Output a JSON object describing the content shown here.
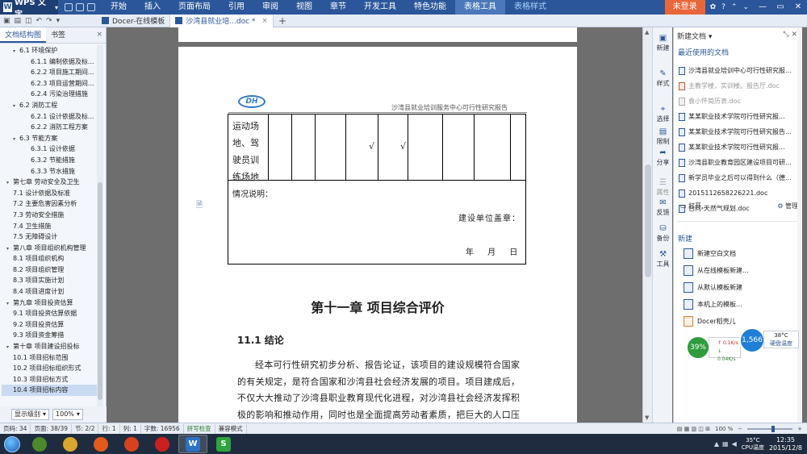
{
  "menubar": {
    "app_title": "WPS 文字",
    "menus": [
      "开始",
      "插入",
      "页面布局",
      "引用",
      "审阅",
      "视图",
      "章节",
      "开发工具",
      "特色功能"
    ],
    "tool_tabs": [
      "表格工具",
      "表格样式"
    ],
    "login": "未登录"
  },
  "tabbar": {
    "tabs": [
      {
        "label": "Docer-在线模板"
      },
      {
        "label": "沙湾县就业培...doc *"
      }
    ],
    "add": "+"
  },
  "left_panel": {
    "tabs": [
      "文档结构图",
      "书签"
    ],
    "outline": [
      {
        "label": "6.1 环境保护",
        "level": 2,
        "toggle": "▾"
      },
      {
        "label": "6.1.1 编制依据及标...",
        "level": 3
      },
      {
        "label": "6.2.2 项目施工期间...",
        "level": 3
      },
      {
        "label": "6.2.3 项目运营期间...",
        "level": 3
      },
      {
        "label": "6.2.4 污染治理措施",
        "level": 3
      },
      {
        "label": "6.2 消防工程",
        "level": 2,
        "toggle": "▾"
      },
      {
        "label": "6.2.1 设计依据及标...",
        "level": 3
      },
      {
        "label": "6.2.2 消防工程方案",
        "level": 3
      },
      {
        "label": "6.3 节能方案",
        "level": 2,
        "toggle": "▾"
      },
      {
        "label": "6.3.1 设计依据",
        "level": 3
      },
      {
        "label": "6.3.2 节能措施",
        "level": 3
      },
      {
        "label": "6.3.3 节水措施",
        "level": 3
      },
      {
        "label": "第七章 劳动安全及卫生",
        "level": 1,
        "toggle": "▾"
      },
      {
        "label": "7.1 设计依据及标准",
        "level": 2
      },
      {
        "label": "7.2 主要危害因素分析",
        "level": 2
      },
      {
        "label": "7.3 劳动安全措施",
        "level": 2
      },
      {
        "label": "7.4 卫生措施",
        "level": 2
      },
      {
        "label": "7.5 无障碍设计",
        "level": 2
      },
      {
        "label": "第八章 项目组织机构管理",
        "level": 1,
        "toggle": "▾"
      },
      {
        "label": "8.1 项目组织机构",
        "level": 2
      },
      {
        "label": "8.2 项目组织管理",
        "level": 2
      },
      {
        "label": "8.3 项目实施计划",
        "level": 2
      },
      {
        "label": "8.4 项目进度计划",
        "level": 2
      },
      {
        "label": "第九章 项目投资估算",
        "level": 1,
        "toggle": "▾"
      },
      {
        "label": "9.1 项目投资估算依据",
        "level": 2
      },
      {
        "label": "9.2 项目投资估算",
        "level": 2
      },
      {
        "label": "9.3 项目资金筹措",
        "level": 2
      },
      {
        "label": "第十章 项目建设招投标",
        "level": 1,
        "toggle": "▾"
      },
      {
        "label": "10.1 项目招标范围",
        "level": 2
      },
      {
        "label": "10.2 项目招标组织形式",
        "level": 2
      },
      {
        "label": "10.3 项目招标方式",
        "level": 2
      },
      {
        "label": "10.4 项目招标内容",
        "level": 2,
        "selected": true
      }
    ],
    "display_level": "显示级别",
    "zoom": "100%"
  },
  "document": {
    "header_logo": "DH",
    "header_text": "沙湾县就业培训服务中心可行性研究报告",
    "table_row_label": [
      "运动场",
      "地、驾",
      "驶员训",
      "练场地"
    ],
    "checks": [
      "√",
      "√"
    ],
    "situation": "情况说明：",
    "seal": "建设单位盖章：",
    "date": "年 月 日",
    "chapter_title": "第十一章  项目综合评价",
    "section_title": "11.1  结论",
    "paragraph": "经本可行性研究初步分析、报告论证，该项目的建设规模符合国家的有关规定，是符合国家和沙湾县社会经济发展的项目。项目建成后，不仅大大推动了沙湾县职业教育现代化进程，对沙湾县社会经济发挥积极的影响和推动作用，同时也是全面提高劳动者素质，把巨大的人口压力转化为人力资源优势的重要途径。目前，已具备了启动"
  },
  "icon_strip": [
    {
      "label": "新建",
      "icon": "new-doc-icon"
    },
    {
      "label": "样式",
      "icon": "style-icon"
    },
    {
      "label": "选择",
      "icon": "select-icon"
    },
    {
      "label": "限制",
      "icon": "restrict-icon"
    },
    {
      "label": "分享",
      "icon": "share-icon"
    },
    {
      "label": "属性",
      "icon": "property-icon"
    },
    {
      "label": "反馈",
      "icon": "feedback-icon"
    },
    {
      "label": "备份",
      "icon": "backup-icon"
    },
    {
      "label": "工具",
      "icon": "tool-icon"
    }
  ],
  "task_pane": {
    "title": "新建文档 ▾",
    "recent_title": "最近使用的文档",
    "recent": [
      {
        "name": "沙湾县就业培训中心可行性研究报...",
        "type": "doc"
      },
      {
        "name": "主教学楼，实训楼。报告厅.doc",
        "type": "red",
        "dim": true
      },
      {
        "name": "袁小怀简历表.doc",
        "type": "gray",
        "dim": true
      },
      {
        "name": "某某职业技术学院可行性研究报...",
        "type": "doc"
      },
      {
        "name": "某某职业技术学院可行性研究报告...",
        "type": "doc"
      },
      {
        "name": "某某职业技术学院可行性研究报...",
        "type": "doc"
      },
      {
        "name": "沙湾县职业教育园区建设项目可研...",
        "type": "doc"
      },
      {
        "name": "新学员毕业之后可以得到什么（德...",
        "type": "doc"
      },
      {
        "name": "2015112658226221.doc",
        "type": "doc"
      },
      {
        "name": "合同-天然气规划.doc",
        "type": "doc"
      }
    ],
    "open": "打开...",
    "manage": "管理",
    "new_title": "新建",
    "new_items": [
      {
        "name": "新建空白文档"
      },
      {
        "name": "从在线模板新建..."
      },
      {
        "name": "从默认模板新建"
      },
      {
        "name": "本机上的模板..."
      },
      {
        "name": "Docer稻壳儿",
        "orange": true
      }
    ]
  },
  "monitor": {
    "mem_percent": "39%",
    "up_speed": "0.1K/s",
    "down_speed": "0.04K/s",
    "cpu_mhz": "1,566",
    "temp": "38°C",
    "temp_label": "硬盘温度"
  },
  "status_bar": {
    "items": [
      "页码: 34",
      "页面: 38/39",
      "节: 2/2",
      "行: 1",
      "列: 1",
      "字数: 16956",
      "拼写检查",
      "兼容模式"
    ],
    "zoom": "100 %"
  },
  "taskbar": {
    "apps": [
      {
        "name": "explorer",
        "color": "#4b8a2b"
      },
      {
        "name": "folder",
        "color": "#d9a62e"
      },
      {
        "name": "media",
        "color": "#e35a1b"
      },
      {
        "name": "player",
        "color": "#d6421c"
      },
      {
        "name": "opera",
        "color": "#cc1f1f"
      },
      {
        "name": "wps-writer",
        "color": "#2b72c7",
        "glyph": "W",
        "active": true
      },
      {
        "name": "wps-sheet",
        "color": "#2fa33f",
        "glyph": "S"
      }
    ],
    "cpu_temp": "35°C",
    "cpu_label": "CPU温度",
    "time": "12:35",
    "date": "2015/12/8"
  }
}
